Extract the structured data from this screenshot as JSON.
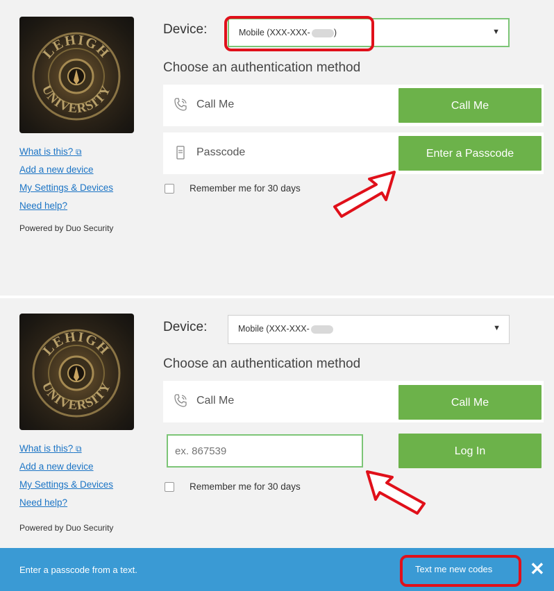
{
  "panel1": {
    "device_label": "Device:",
    "device_value": "Mobile (XXX-XXX-",
    "device_value_suffix": ")",
    "choose_text": "Choose an authentication method",
    "call_label": "Call Me",
    "call_button": "Call Me",
    "passcode_label": "Passcode",
    "passcode_button": "Enter a Passcode",
    "remember": "Remember me for 30 days"
  },
  "panel2": {
    "device_label": "Device:",
    "device_value": "Mobile (XXX-XXX-",
    "choose_text": "Choose an authentication method",
    "call_label": "Call Me",
    "call_button": "Call Me",
    "passcode_placeholder": "ex. 867539",
    "login_button": "Log In",
    "remember": "Remember me for 30 days"
  },
  "sidebar": {
    "links": [
      "What is this?",
      "Add a new device",
      "My Settings & Devices",
      "Need help?"
    ],
    "powered": "Powered by Duo Security"
  },
  "logo": {
    "text_top": "LEHIGH",
    "text_bottom": "UNIVERSITY"
  },
  "bar": {
    "message": "Enter a passcode from a text.",
    "text_me": "Text me new codes",
    "close": "✕"
  },
  "colors": {
    "green": "#6cb24a",
    "blue_bar": "#3a9ad4",
    "link": "#1b74c5",
    "highlight_red": "#e0101a"
  }
}
